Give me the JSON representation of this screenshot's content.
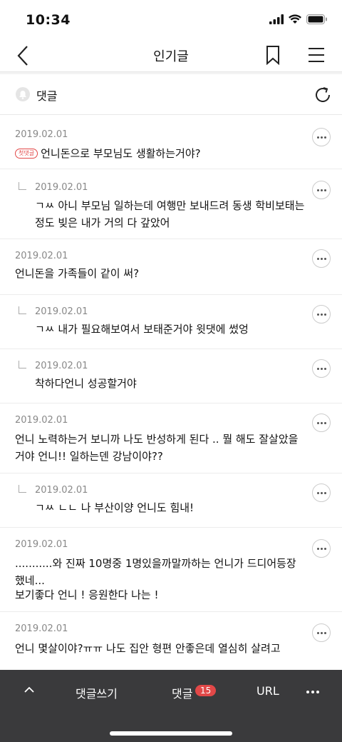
{
  "status_bar": {
    "time": "10:34"
  },
  "nav": {
    "title": "인기글"
  },
  "comments_header": {
    "label": "댓글"
  },
  "comments": [
    {
      "date": "2019.02.01",
      "badge": "첫댓글",
      "text": "언니돈으로 부모님도 생활하는거야?",
      "is_reply": false
    },
    {
      "date": "2019.02.01",
      "text": "ㄱㅆ 아니 부모님 일하는데 여행만 보내드려 동생 학비보태는정도 빚은 내가 거의 다 갚았어",
      "is_reply": true
    },
    {
      "date": "2019.02.01",
      "text": "언니돈을 가족들이 같이 써?",
      "is_reply": false
    },
    {
      "date": "2019.02.01",
      "text": "ㄱㅆ 내가 필요해보여서 보태준거야 윗댓에 썼엉",
      "is_reply": true
    },
    {
      "date": "2019.02.01",
      "text": "착하다언니 성공할거야",
      "is_reply": true
    },
    {
      "date": "2019.02.01",
      "text": "언니 노력하는거 보니까 나도 반성하게 된다 .. 뭘 해도 잘살았을거야 언니!! 일하는덴 강남이야??",
      "is_reply": false
    },
    {
      "date": "2019.02.01",
      "text": "ㄱㅆ ㄴㄴ 나 부산이양 언니도 힘내!",
      "is_reply": true
    },
    {
      "date": "2019.02.01",
      "text": "...........와 진짜 10명중 1명있을까말까하는 언니가 드디어등장했네...",
      "text2": "보기좋다 언니 ! 응원한다 나는 !",
      "is_reply": false
    },
    {
      "date": "2019.02.01",
      "text": "언니 몇살이야?ㅠㅠ 나도 집안 형편 안좋은데 열심히 살려고",
      "is_reply": false
    }
  ],
  "bottom_bar": {
    "write_label": "댓글쓰기",
    "comment_label": "댓글",
    "comment_count": "15",
    "url_label": "URL"
  }
}
